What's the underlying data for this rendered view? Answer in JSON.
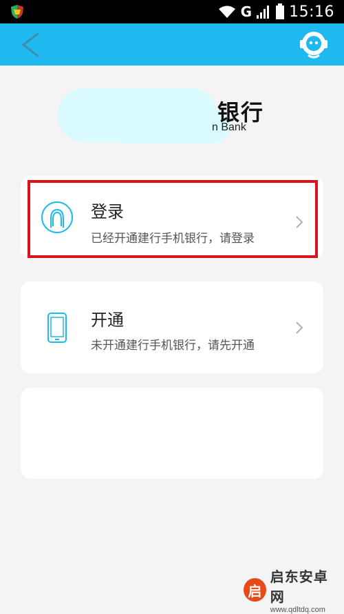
{
  "status_bar": {
    "network": "G",
    "time": "15:16"
  },
  "logo": {
    "text": "银行",
    "subtext": "n Bank"
  },
  "cards": [
    {
      "title": "登录",
      "description": "已经开通建行手机银行，请登录",
      "icon": "user-icon",
      "highlighted": true
    },
    {
      "title": "开通",
      "description": "未开通建行手机银行，请先开通",
      "icon": "phone-icon"
    }
  ],
  "colors": {
    "accent": "#1fb8ef",
    "highlight": "#d8131b"
  },
  "watermark": {
    "logo": "启",
    "name": "启东安卓网",
    "url": "www.qdltdq.com"
  }
}
